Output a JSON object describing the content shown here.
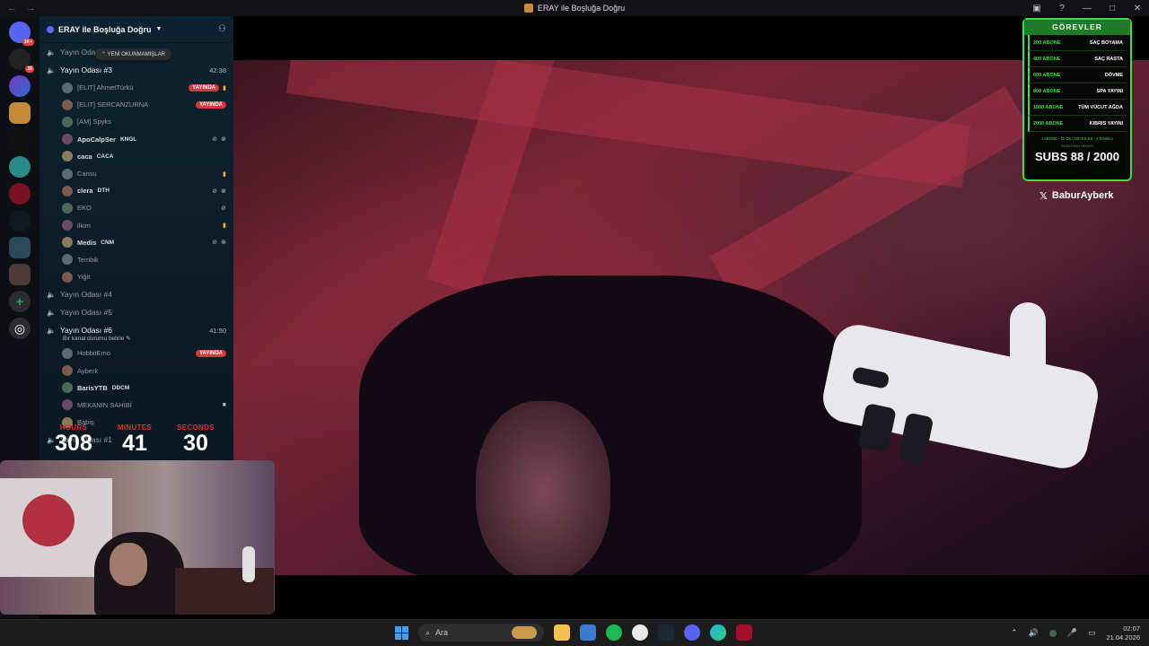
{
  "window": {
    "title": "ERAY ile Boşluğa Doğru",
    "nav_back": "←",
    "nav_forward": "→"
  },
  "rail": {
    "badges": [
      "1K+",
      "16"
    ]
  },
  "guild": {
    "name": "ERAY ile Boşluğa Doğru",
    "unread_pill": "YENİ OKUNMAMIŞLAR",
    "live_label": "YAYINDA"
  },
  "channels": [
    {
      "name": "Yayın Odası #2",
      "time": "",
      "active": false
    },
    {
      "name": "Yayın Odası #3",
      "time": "42:38",
      "active": true
    },
    {
      "name": "Yayın Odası #4",
      "time": "",
      "active": false
    },
    {
      "name": "Yayın Odası #5",
      "time": "",
      "active": false
    },
    {
      "name": "Yayın Odası #6",
      "time": "41:50",
      "active": true,
      "status": "Bir kanal durumu belirle ✎"
    },
    {
      "name": "Yayın Odası #1",
      "time": "",
      "active": false
    }
  ],
  "room3_users": [
    {
      "name": "[ELIT] AhmetTürkü",
      "tag": "",
      "live": true,
      "icons": "gold"
    },
    {
      "name": "[ELIT] SERCANZURNA",
      "tag": "",
      "live": true,
      "icons": ""
    },
    {
      "name": "[AM] Spyks",
      "tag": "",
      "live": false,
      "icons": ""
    },
    {
      "name": "ApoCalpSer",
      "tag": "KNGL",
      "live": false,
      "icons": "mute"
    },
    {
      "name": "caca",
      "tag": "CACA",
      "live": false,
      "icons": ""
    },
    {
      "name": "Cansu",
      "tag": "",
      "live": false,
      "icons": "gold"
    },
    {
      "name": "clera",
      "tag": "DTH",
      "live": false,
      "icons": "mute"
    },
    {
      "name": "EKO",
      "tag": "",
      "live": false,
      "icons": "mic"
    },
    {
      "name": "ilkim",
      "tag": "",
      "live": false,
      "icons": "gold"
    },
    {
      "name": "Medis",
      "tag": "CNM",
      "live": false,
      "icons": "mute"
    },
    {
      "name": "Tembik",
      "tag": "",
      "live": false,
      "icons": ""
    },
    {
      "name": "Yiğit",
      "tag": "",
      "live": false,
      "icons": ""
    }
  ],
  "room6_users": [
    {
      "name": "HobbitEmo",
      "tag": "",
      "live": true,
      "icons": ""
    },
    {
      "name": "Ayberk",
      "tag": "",
      "live": false,
      "icons": ""
    },
    {
      "name": "BarisYTB",
      "tag": "DDCM",
      "live": false,
      "icons": ""
    },
    {
      "name": "MEKANIN SAHİBİ",
      "tag": "",
      "live": false,
      "icons": "cam"
    },
    {
      "name": "Babiş",
      "tag": "",
      "live": false,
      "icons": ""
    }
  ],
  "timer": {
    "hours_label": "HOURS",
    "minutes_label": "MINUTES",
    "seconds_label": "SECONDS",
    "hours": "308",
    "minutes": "41",
    "seconds": "30"
  },
  "goals": {
    "title": "GÖREVLER",
    "items": [
      {
        "amount": "200 ABONE",
        "task": "SAÇ BOYAMA"
      },
      {
        "amount": "400 ABONE",
        "task": "SAÇ RASTA"
      },
      {
        "amount": "600 ABONE",
        "task": "DÖVME"
      },
      {
        "amount": "800 ABONE",
        "task": "SPA YAYINI"
      },
      {
        "amount": "1000 ABONE",
        "task": "TÜM VÜCUT AĞDA"
      },
      {
        "amount": "2000 ABONE",
        "task": "KIBRIS YAYINI"
      }
    ],
    "footnote": "1 ABONE - 10 DK  |  100 KICKS - 2 DAKİKA",
    "subathon_label": "SUBATHON HEDEFİ",
    "subs": "SUBS 88 / 2000"
  },
  "social": {
    "handle": "BaburAyberk",
    "icon": "x-logo"
  },
  "taskbar": {
    "search_placeholder": "Ara",
    "time": "02:07",
    "date": "21.04.2026"
  },
  "colors": {
    "accent_green": "#3ae04a",
    "live_red": "#da373c",
    "timer_label_red": "#e03030"
  }
}
